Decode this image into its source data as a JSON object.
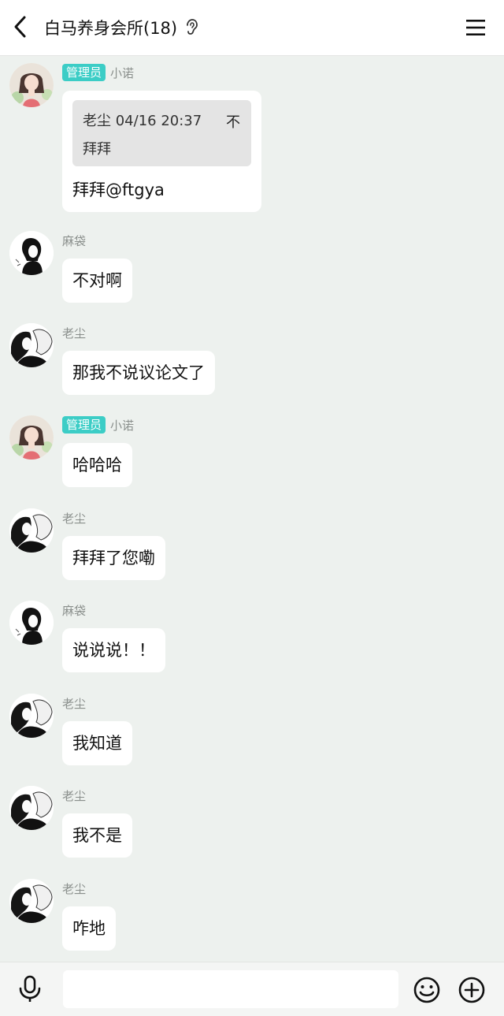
{
  "header": {
    "title": "白马养身会所(18)",
    "back_icon": "chevron-left-icon",
    "ear_icon": "ear-icon",
    "menu_icon": "menu-icon"
  },
  "messages": [
    {
      "sender": "小诺",
      "badge": "管理员",
      "avatar": "girl",
      "quote": {
        "header": "老尘 04/16 20:37",
        "pin": "不",
        "text": "拜拜"
      },
      "text": "拜拜@ftgya"
    },
    {
      "sender": "麻袋",
      "avatar": "bw-single",
      "text": "不对啊"
    },
    {
      "sender": "老尘",
      "avatar": "bw-couple",
      "text": "那我不说议论文了"
    },
    {
      "sender": "小诺",
      "badge": "管理员",
      "avatar": "girl",
      "text": "哈哈哈"
    },
    {
      "sender": "老尘",
      "avatar": "bw-couple",
      "text": "拜拜了您嘞"
    },
    {
      "sender": "麻袋",
      "avatar": "bw-single",
      "text": "说说说！！"
    },
    {
      "sender": "老尘",
      "avatar": "bw-couple",
      "text": "我知道"
    },
    {
      "sender": "老尘",
      "avatar": "bw-couple",
      "text": "我不是"
    },
    {
      "sender": "老尘",
      "avatar": "bw-couple",
      "text": "咋地"
    }
  ],
  "input_bar": {
    "placeholder": "",
    "mic_icon": "microphone-icon",
    "emoji_icon": "emoji-icon",
    "plus_icon": "plus-circle-icon"
  },
  "colors": {
    "chat_background": "#edf1ee",
    "admin_badge": "#3ccdc6",
    "bubble": "#ffffff"
  }
}
